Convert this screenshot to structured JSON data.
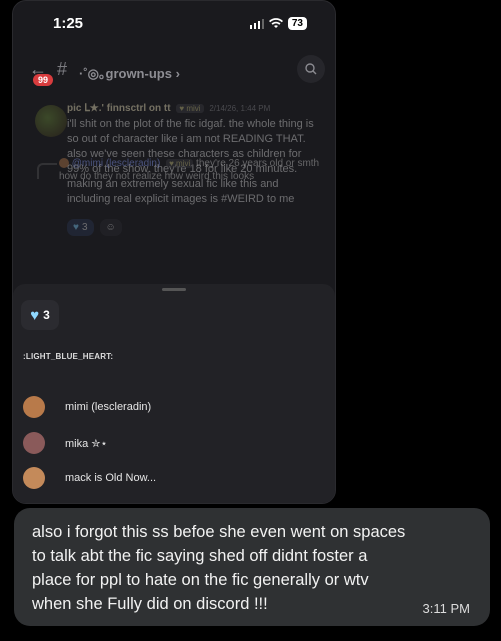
{
  "status": {
    "time": "1:25",
    "battery": "73"
  },
  "header": {
    "back_badge": "99",
    "channel": "·˚◎｡grown-ups",
    "chevron": "›"
  },
  "message": {
    "author": "pic ᒪ★.' finnsctrl on tt",
    "tag": "mivi",
    "timestamp": "2/14/26, 1:44 PM",
    "lines": [
      "i'll shit on the plot of the fic idgaf. the whole thing is",
      "so out of character like i am not READING THAT.",
      "also we've seen these characters as children for",
      "99% of the show. they're 18 for like 20 minutes.",
      "making an extremely sexual fic like this and",
      "including real explicit images is #WEIRD to me"
    ],
    "reaction_count": "3"
  },
  "reply": {
    "author": "@mimi (lescleradin)",
    "tag": "mivi",
    "text": "they're 26 years old or smth how do they not realize how weird this looks"
  },
  "sheet": {
    "count": "3",
    "emoji_name": ":LIGHT_BLUE_HEART:",
    "users": [
      {
        "name": "mimi (lescleradin)",
        "color": "#b87a4a"
      },
      {
        "name": "mika ✮⋆",
        "color": "#8a5a5a"
      },
      {
        "name": "mack is Old Now...",
        "color": "#c48a5a"
      }
    ]
  },
  "bubble": {
    "lines": [
      "also i forgot this ss befoe she even went on spaces",
      "to talk abt the fic saying shed off didnt foster a",
      "place for ppl to hate on the fic generally or wtv",
      "when she Fully did on discord !!!"
    ],
    "time": "3:11 PM"
  }
}
